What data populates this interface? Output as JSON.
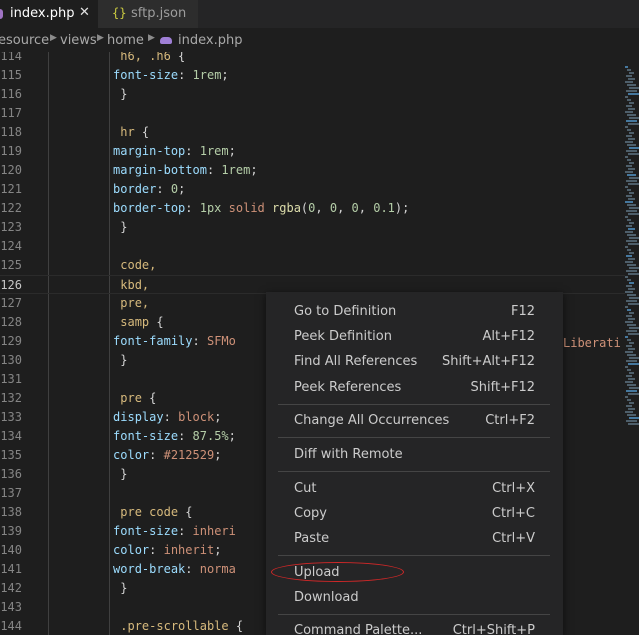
{
  "tabs": [
    {
      "label": "index.php",
      "close": "✕"
    },
    {
      "label": "sftp.json",
      "brace": "{}"
    }
  ],
  "breadcrumb": {
    "items": [
      "esource",
      "views",
      "home",
      "index.php"
    ]
  },
  "code": {
    "current_line": "126",
    "lines": [
      {
        "n": "114",
        "text": "h6, .h6 {"
      },
      {
        "n": "115",
        "text": "    font-size: 1rem;"
      },
      {
        "n": "116",
        "text": "}"
      },
      {
        "n": "117",
        "text": ""
      },
      {
        "n": "118",
        "text": "hr {"
      },
      {
        "n": "119",
        "text": "    margin-top: 1rem;"
      },
      {
        "n": "120",
        "text": "    margin-bottom: 1rem;"
      },
      {
        "n": "121",
        "text": "    border: 0;"
      },
      {
        "n": "122",
        "text": "    border-top: 1px solid rgba(0, 0, 0, 0.1);"
      },
      {
        "n": "123",
        "text": "}"
      },
      {
        "n": "124",
        "text": ""
      },
      {
        "n": "125",
        "text": "code,"
      },
      {
        "n": "126",
        "text": "kbd,"
      },
      {
        "n": "127",
        "text": "pre,"
      },
      {
        "n": "128",
        "text": "samp {"
      },
      {
        "n": "129",
        "text": "    font-family: SFMo"
      },
      {
        "n": "130",
        "text": "}"
      },
      {
        "n": "131",
        "text": ""
      },
      {
        "n": "132",
        "text": "pre {"
      },
      {
        "n": "133",
        "text": "    display: block;"
      },
      {
        "n": "134",
        "text": "    font-size: 87.5%;"
      },
      {
        "n": "135",
        "text": "    color: #212529;"
      },
      {
        "n": "136",
        "text": "}"
      },
      {
        "n": "137",
        "text": ""
      },
      {
        "n": "138",
        "text": "pre code {"
      },
      {
        "n": "139",
        "text": "    font-size: inheri"
      },
      {
        "n": "140",
        "text": "    color: inherit;"
      },
      {
        "n": "141",
        "text": "    word-break: norma"
      },
      {
        "n": "142",
        "text": "}"
      },
      {
        "n": "143",
        "text": ""
      },
      {
        "n": "144",
        "text": ".pre-scrollable {"
      }
    ],
    "overflow_text": "Liberati"
  },
  "context_menu": {
    "items": [
      {
        "label": "Go to Definition",
        "shortcut": "F12"
      },
      {
        "label": "Peek Definition",
        "shortcut": "Alt+F12"
      },
      {
        "label": "Find All References",
        "shortcut": "Shift+Alt+F12"
      },
      {
        "label": "Peek References",
        "shortcut": "Shift+F12"
      },
      {
        "label": "Change All Occurrences",
        "shortcut": "Ctrl+F2"
      },
      {
        "label": "Diff with Remote",
        "shortcut": ""
      },
      {
        "label": "Cut",
        "shortcut": "Ctrl+X"
      },
      {
        "label": "Copy",
        "shortcut": "Ctrl+C"
      },
      {
        "label": "Paste",
        "shortcut": "Ctrl+V"
      },
      {
        "label": "Upload",
        "shortcut": ""
      },
      {
        "label": "Download",
        "shortcut": ""
      },
      {
        "label": "Command Palette...",
        "shortcut": "Ctrl+Shift+P"
      }
    ]
  },
  "colors": {
    "editor_bg": "#1e1e1e",
    "menu_bg": "#252526",
    "selector": "#d7ba7d",
    "property": "#9cdcfe",
    "number": "#b5cea8",
    "string_value": "#ce9178",
    "highlight_ring": "#d02828"
  },
  "icons": [
    "close-icon",
    "json-icon",
    "php-icon",
    "chevron-right-icon"
  ]
}
